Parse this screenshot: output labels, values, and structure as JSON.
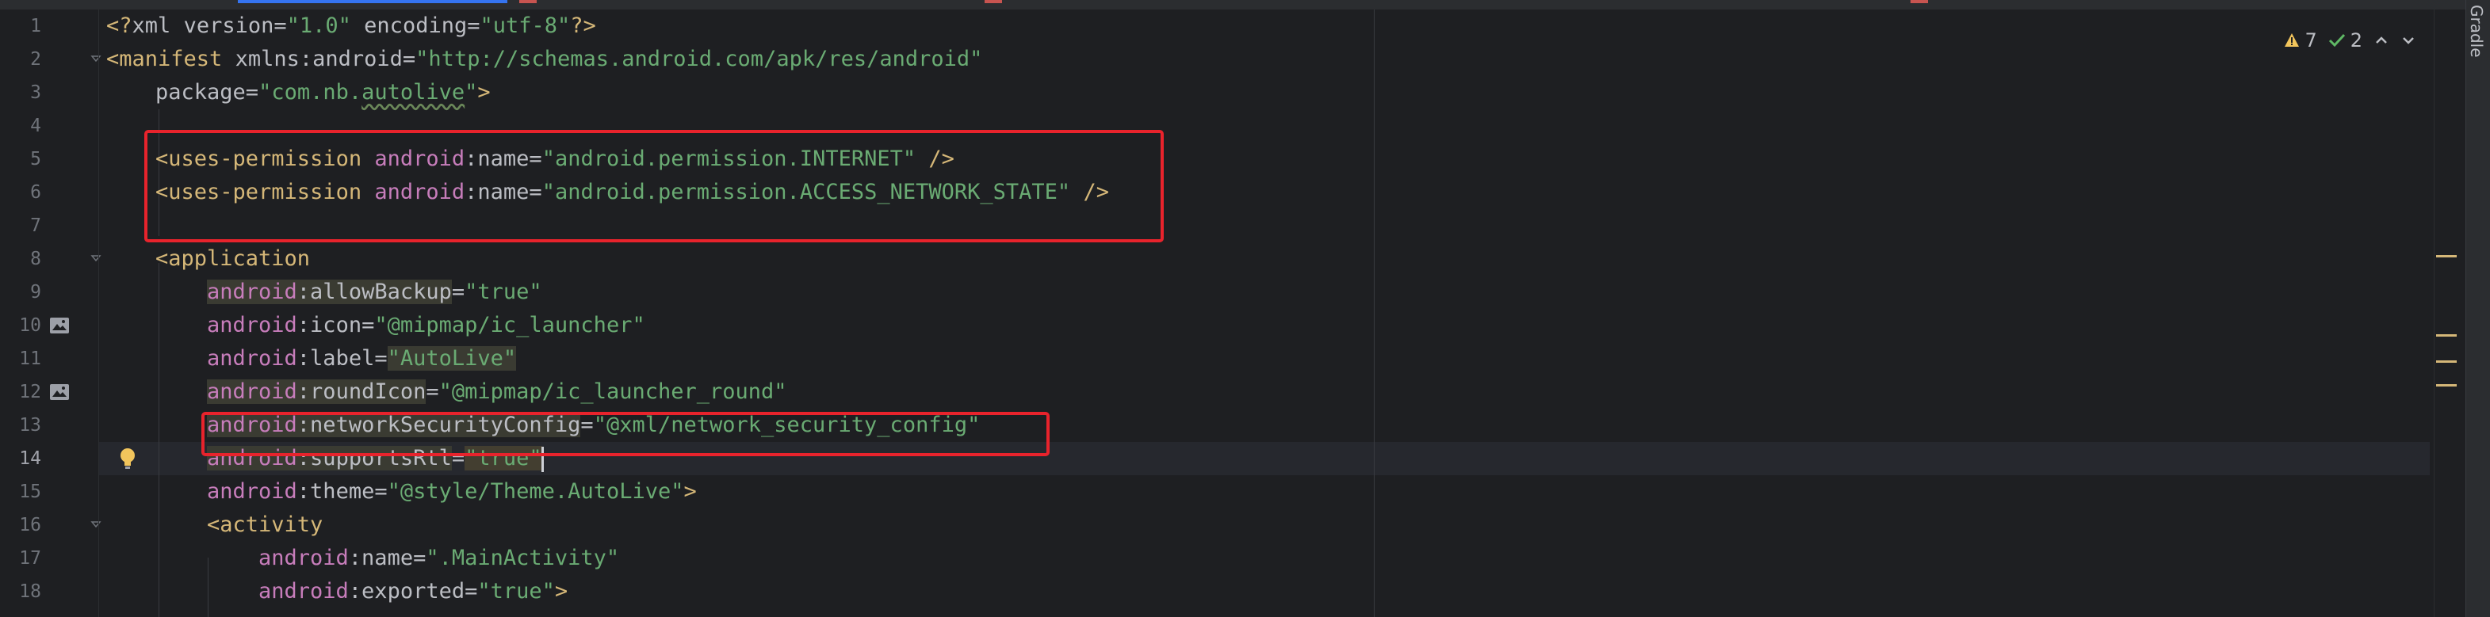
{
  "editor": {
    "current_line": 14,
    "lines": [
      {
        "n": "1"
      },
      {
        "n": "2"
      },
      {
        "n": "3"
      },
      {
        "n": "4"
      },
      {
        "n": "5"
      },
      {
        "n": "6"
      },
      {
        "n": "7"
      },
      {
        "n": "8"
      },
      {
        "n": "9"
      },
      {
        "n": "10"
      },
      {
        "n": "11"
      },
      {
        "n": "12"
      },
      {
        "n": "13"
      },
      {
        "n": "14"
      },
      {
        "n": "15"
      },
      {
        "n": "16"
      },
      {
        "n": "17"
      },
      {
        "n": "18"
      }
    ],
    "code": {
      "l1": {
        "open": "<?",
        "kw": "xml",
        "a1": "version",
        "v1": "\"1.0\"",
        "a2": "encoding",
        "v2": "\"utf-8\"",
        "close": "?>"
      },
      "l2": {
        "tag": "<manifest",
        "ns": "xmlns:android",
        "val": "\"http://schemas.android.com/apk/res/android\""
      },
      "l3": {
        "attr": "package",
        "val_q1": "\"com.nb.",
        "val_wavy": "autolive",
        "val_q2": "\"",
        "close": ">"
      },
      "l5": {
        "tag": "<uses-permission",
        "ns": "android",
        "attr": ":name=",
        "val": "\"android.permission.INTERNET\"",
        "close": " />"
      },
      "l6": {
        "tag": "<uses-permission",
        "ns": "android",
        "attr": ":name=",
        "val": "\"android.permission.ACCESS_NETWORK_STATE\"",
        "close": " />"
      },
      "l8": {
        "tag": "<application"
      },
      "l9": {
        "ns": "android",
        "attr": ":allowBackup",
        "val": "\"true\""
      },
      "l10": {
        "ns": "android",
        "attr": ":icon",
        "val": "\"@mipmap/ic_launcher\""
      },
      "l11": {
        "ns": "android",
        "attr": ":label",
        "val": "\"AutoLive\""
      },
      "l12": {
        "ns": "android",
        "attr": ":roundIcon",
        "val": "\"@mipmap/ic_launcher_round\""
      },
      "l13": {
        "ns": "android",
        "attr": ":networkSecurityConfig",
        "val": "\"@xml/network_security_config\""
      },
      "l14": {
        "ns": "android",
        "attr": ":supportsRtl",
        "val": "\"true\""
      },
      "l15": {
        "ns": "android",
        "attr": ":theme",
        "val": "\"@style/Theme.AutoLive\"",
        "close": ">"
      },
      "l16": {
        "tag": "<activity"
      },
      "l17": {
        "ns": "android",
        "attr": ":name",
        "val": "\".MainActivity\""
      },
      "l18": {
        "ns": "android",
        "attr": ":exported",
        "val": "\"true\"",
        "close": ">"
      }
    }
  },
  "inspections": {
    "warnings": "7",
    "weak_warnings": "2"
  },
  "sidebar": {
    "gradle_label": "Gradle"
  },
  "colors": {
    "annotation_box": "#e8232c",
    "warning": "#f2c55c",
    "ok_check": "#5fb865"
  }
}
